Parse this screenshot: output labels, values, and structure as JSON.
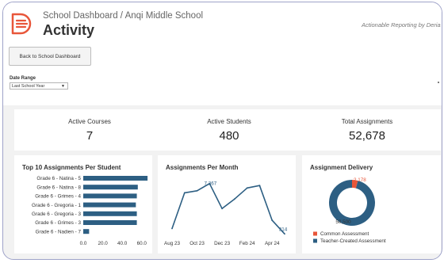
{
  "header": {
    "breadcrumb": "School Dashboard / Anqi Middle School",
    "title": "Activity",
    "tagline": "Actionable Reporting by Deria"
  },
  "toolbar": {
    "back_label": "Back to School Dashboard"
  },
  "filter": {
    "label": "Date Range",
    "value": "Last School Year"
  },
  "kpis": [
    {
      "label": "Active Courses",
      "value": "7"
    },
    {
      "label": "Active Students",
      "value": "480"
    },
    {
      "label": "Total Assignments",
      "value": "52,678"
    }
  ],
  "charts": {
    "top10": {
      "title": "Top 10 Assignments Per Student"
    },
    "per_month": {
      "title": "Assignments Per Month"
    },
    "delivery": {
      "title": "Assignment Delivery"
    }
  },
  "colors": {
    "brand": "#e8563a",
    "bar": "#2d5f83",
    "line": "#2d5f83",
    "common": "#e8563a",
    "teacher": "#2d5f83"
  },
  "chart_data": [
    {
      "type": "bar",
      "orientation": "horizontal",
      "title": "Top 10 Assignments Per Student",
      "categories": [
        "Grade 6 - Natina - 5",
        "Grade 6 - Natina - 8",
        "Grade 6 - Grimes - 4",
        "Grade 6 - Gregoria - 1",
        "Grade 6 - Gregoria - 3",
        "Grade 6 - Grimes - 3",
        "Grade 6 - Nadien - 7"
      ],
      "values": [
        66,
        56,
        55,
        54,
        55,
        55,
        6
      ],
      "xticks": [
        "0.0",
        "20.0",
        "40.0",
        "60.0"
      ],
      "xlim": [
        0,
        70
      ],
      "grid": false
    },
    {
      "type": "line",
      "title": "Assignments Per Month",
      "x": [
        "Aug 23",
        "Sep 23",
        "Oct 23",
        "Nov 23",
        "Dec 23",
        "Jan 24",
        "Feb 24",
        "Mar 24",
        "Apr 24",
        "May 24"
      ],
      "y": [
        1100,
        6300,
        6600,
        7650,
        4000,
        5400,
        7000,
        7367,
        2300,
        314
      ],
      "xticks": [
        "Aug 23",
        "Oct 23",
        "Dec 23",
        "Feb 24",
        "Apr 24"
      ],
      "labels": {
        "max": "7,367",
        "last": "314"
      },
      "ylim": [
        0,
        9000
      ],
      "grid": false
    },
    {
      "type": "pie",
      "style": "donut",
      "title": "Assignment Delivery",
      "slices": [
        {
          "name": "Common Assessment",
          "value": 2178,
          "label": "2,178"
        },
        {
          "name": "Teacher-Created Assessment",
          "value": 50500,
          "label": "50,500"
        }
      ],
      "legend": "bottom"
    }
  ]
}
